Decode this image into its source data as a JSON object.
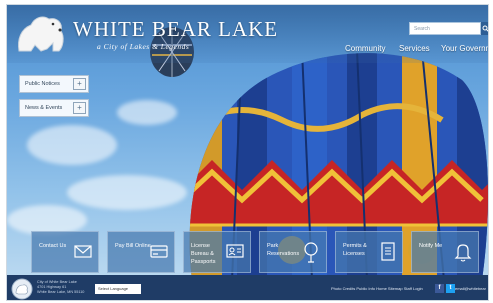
{
  "header": {
    "title": "WHITE BEAR LAKE",
    "tagline": "a City of Lakes & Legends",
    "search_placeholder": "Search"
  },
  "nav": {
    "items": [
      {
        "label": "Community"
      },
      {
        "label": "Services"
      },
      {
        "label": "Your Government"
      }
    ]
  },
  "sidebar": {
    "items": [
      {
        "label": "Public Notices"
      },
      {
        "label": "News & Events"
      }
    ]
  },
  "tiles": [
    {
      "label": "Contact Us",
      "icon": "envelope-icon"
    },
    {
      "label": "Pay Bill Online",
      "icon": "credit-card-icon"
    },
    {
      "label": "License Bureau & Passports",
      "icon": "id-card-icon"
    },
    {
      "label": "Park Reservations",
      "icon": "tree-icon"
    },
    {
      "label": "Permits & Licenses",
      "icon": "document-icon"
    },
    {
      "label": "Notify Me",
      "icon": "bell-icon"
    }
  ],
  "footer": {
    "address_lines": [
      "City of White Bear Lake",
      "4701 Highway 61",
      "White Bear Lake, MN 55110"
    ],
    "language_label": "Select Language",
    "links": "Photo Credits   Public Info   Home   Sitemap   Staff Login",
    "email": "email@whitebear",
    "facebook_glyph": "f",
    "twitter_glyph": "t"
  },
  "colors": {
    "footer_bg": "#1f3c66",
    "tile_bg": "#4678af",
    "facebook": "#3b5998",
    "twitter": "#1da1f2"
  }
}
